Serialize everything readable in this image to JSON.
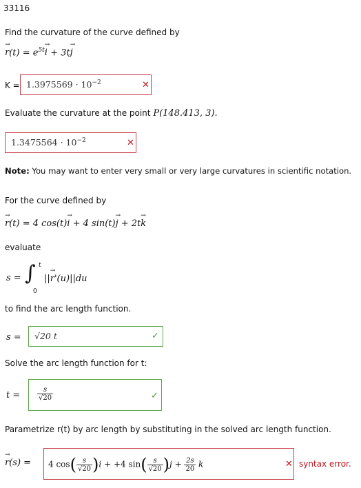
{
  "problem_id": "33116",
  "part1": {
    "prompt": "Find the curvature of the curve defined by",
    "curve_prefix": "r(t) = e",
    "exponent": "5t",
    "curve_suffix": " + 3t",
    "k_label": "K =",
    "answer_mantissa": "1.3975569",
    "answer_exponent": "−2",
    "base": " · 10"
  },
  "part2": {
    "prompt_prefix": "Evaluate the curvature at the point",
    "point": "P(148.413, 3).",
    "answer_mantissa": "1.3475564",
    "answer_exponent": "−2",
    "base": " · 10"
  },
  "note": {
    "bold": "Note:",
    "text": " You may want to enter very small or very large curvatures in scientific notation."
  },
  "part3": {
    "prompt": "For the curve defined by",
    "curve": "r(t) = 4 cos(t)i + 4 sin(t)j + 2tk",
    "evaluate": "evaluate",
    "integral_expr": "||r'(u)||du",
    "lower": "0",
    "upper": "t",
    "s_eq": "s =",
    "arc_prompt": "to find the arc length function.",
    "s_answer": "√20 t",
    "solve_prompt": "Solve the arc length function for t:",
    "t_eq": "t =",
    "t_num": "s",
    "t_den": "√20",
    "param_prompt": "Parametrize r(t) by arc length by substituting in the solved arc length function.",
    "rs_eq": "r(s) =",
    "rs_err": "syntax error."
  }
}
